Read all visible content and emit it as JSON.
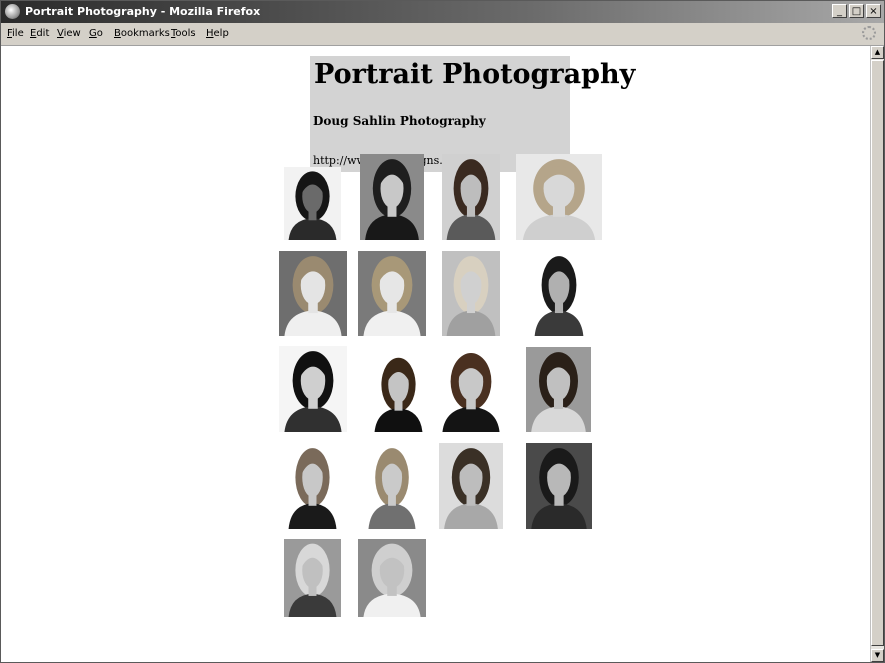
{
  "window": {
    "title": "Portrait Photography - Mozilla Firefox",
    "controls": [
      "_",
      "□",
      "×"
    ]
  },
  "menubar": {
    "items": [
      "File",
      "Edit",
      "View",
      "Go",
      "Bookmarks",
      "Tools",
      "Help"
    ]
  },
  "header": {
    "title": "Portrait Photography",
    "subtitle": "Doug Sahlin Photography",
    "url": "http://www.dasdesigns.net"
  },
  "gallery": {
    "rows": [
      [
        "portrait-woman-rose-profile",
        "portrait-woman-dark-hair-smiling",
        "portrait-woman-sunglasses",
        "portrait-blonde-woman"
      ],
      [
        "portrait-toddler-boy-1",
        "portrait-toddler-boy-2",
        "portrait-blonde-closeup",
        "portrait-woman-hands-chin"
      ],
      [
        "portrait-woman-bangs-closeup",
        "portrait-businesswoman-1",
        "portrait-businesswoman-2",
        "portrait-woman-long-hair"
      ],
      [
        "portrait-woman-glasses",
        "portrait-woman-short-hair",
        "portrait-woman-flower-hair",
        "portrait-woman-necklace"
      ],
      [
        "portrait-man-desk-reading",
        "portrait-man-desk-smiling"
      ]
    ]
  }
}
